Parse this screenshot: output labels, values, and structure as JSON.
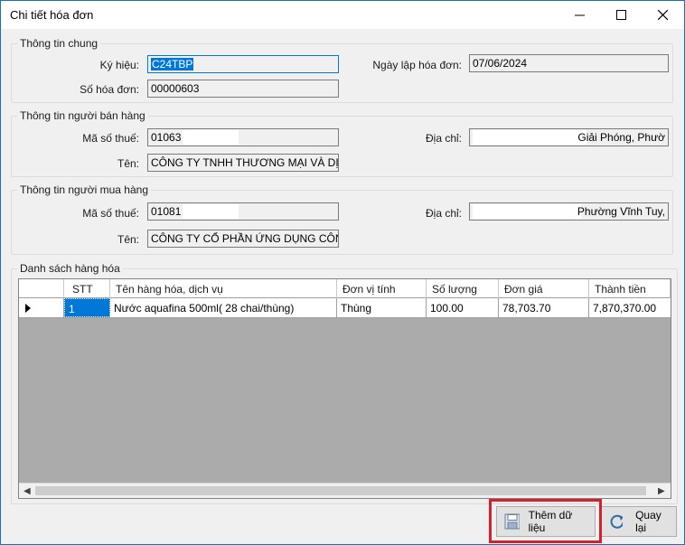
{
  "window": {
    "title": "Chi tiết hóa đơn"
  },
  "general": {
    "group_label": "Thông tin chung",
    "symbol_label": "Ký hiệu:",
    "symbol_value": "C24TBP",
    "number_label": "Số hóa đơn:",
    "number_value": "00000603",
    "date_label": "Ngày lập hóa đơn:",
    "date_value": "07/06/2024"
  },
  "seller": {
    "group_label": "Thông tin người bán hàng",
    "tax_label": "Mã số thuế:",
    "tax_value": "01063",
    "name_label": "Tên:",
    "name_value": "CÔNG TY TNHH THƯƠNG MẠI VÀ DỊCH V",
    "address_label": "Địa chỉ:",
    "address_value": "Giải Phóng, Phườ"
  },
  "buyer": {
    "group_label": "Thông tin người mua hàng",
    "tax_label": "Mã số thuế:",
    "tax_value": "01081",
    "name_label": "Tên:",
    "name_value": "CÔNG TY CỔ PHẦN ỨNG DỤNG CÔNG N",
    "address_label": "Địa chỉ:",
    "address_value": "Phường Vĩnh Tuy,"
  },
  "goods": {
    "group_label": "Danh sách hàng hóa",
    "columns": [
      "STT",
      "Tên hàng hóa, dịch vụ",
      "Đơn vị tính",
      "Số lượng",
      "Đơn giá",
      "Thành tiền"
    ],
    "rows": [
      [
        "1",
        "Nước aquafina 500ml( 28 chai/thùng)",
        "Thùng",
        "100.00",
        "78,703.70",
        "7,870,370.00"
      ]
    ]
  },
  "buttons": {
    "add_label": "Thêm dữ liệu",
    "back_label": "Quay lại"
  },
  "colors": {
    "accent": "#0078d7",
    "highlight": "#d4222a"
  }
}
